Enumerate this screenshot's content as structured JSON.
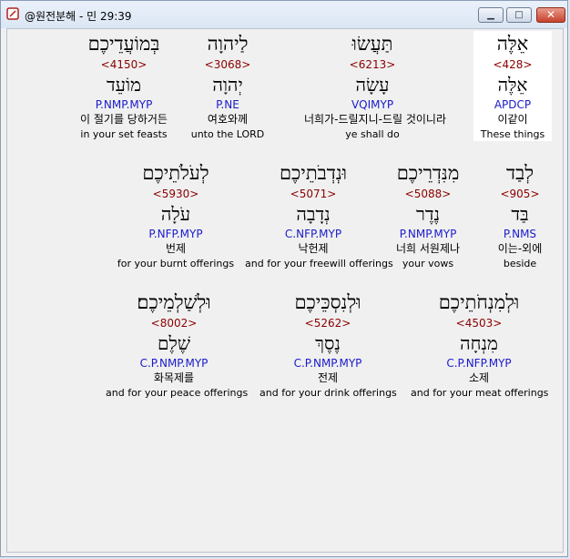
{
  "window": {
    "title": "@원전분해 - 민 29:39"
  },
  "controls": {
    "minimize": "▁",
    "maximize": "□",
    "close": "✕"
  },
  "rows": [
    {
      "words": [
        {
          "hebrew": "בְּמוֹעֲדֵיכֶם",
          "strong": "<4150>",
          "lemma": "מוֹעֵד",
          "morph": "P.NMP.MYP",
          "korean": "이 절기를 당하거든",
          "english": "in your set feasts"
        },
        {
          "hebrew": "לַיהוָה",
          "strong": "<3068>",
          "lemma": "יְהוָה",
          "morph": "P.NE",
          "korean": "여호와께",
          "english": "unto the LORD"
        },
        {
          "hebrew": "תַּעֲשׂוּ",
          "strong": "<6213>",
          "lemma": "עָשָׂה",
          "morph": "VQIMYP",
          "korean": "너희가-드릴지니-드릴 것이니라",
          "english": "ye shall do"
        },
        {
          "hebrew": "אֵלֶּה",
          "strong": "<428>",
          "lemma": "אֵלֶּה",
          "morph": "APDCP",
          "korean": "이같이",
          "english": "These things"
        }
      ]
    },
    {
      "words": [
        {
          "hebrew": "לְעֹלֹתֵיכֶם",
          "strong": "<5930>",
          "lemma": "עֹלָה",
          "morph": "P.NFP.MYP",
          "korean": "번제",
          "english": "for your burnt offerings"
        },
        {
          "hebrew": "וּנְדְבֹתֵיכֶם",
          "strong": "<5071>",
          "lemma": "נְדָבָה",
          "morph": "C.NFP.MYP",
          "korean": "낙헌제",
          "english": "and for your freewill offerings"
        },
        {
          "hebrew": "מִנִּדְרֵיכֶם",
          "strong": "<5088>",
          "lemma": "נֶדֶר",
          "morph": "P.NMP.MYP",
          "korean": "너희 서원제나",
          "english": "your vows"
        },
        {
          "hebrew": "לְבַד",
          "strong": "<905>",
          "lemma": "בַּד",
          "morph": "P.NMS",
          "korean": "이는-외에",
          "english": "beside"
        }
      ]
    },
    {
      "words": [
        {
          "hebrew": "וּלְשַׁלְמֵיכֶם׃",
          "strong": "<8002>",
          "lemma": "שֶׁלֶם",
          "morph": "C.P.NMP.MYP",
          "korean": "화목제를",
          "english": "and for your peace offerings"
        },
        {
          "hebrew": "וּלְנִסְכֵּיכֶם",
          "strong": "<5262>",
          "lemma": "נֶסֶךְ",
          "morph": "C.P.NMP.MYP",
          "korean": "전제",
          "english": "and for your drink offerings"
        },
        {
          "hebrew": "וּלְמִנְחֹתֵיכֶם",
          "strong": "<4503>",
          "lemma": "מִנְחָה",
          "morph": "C.P.NFP.MYP",
          "korean": "소제",
          "english": "and for your meat offerings"
        }
      ]
    }
  ]
}
